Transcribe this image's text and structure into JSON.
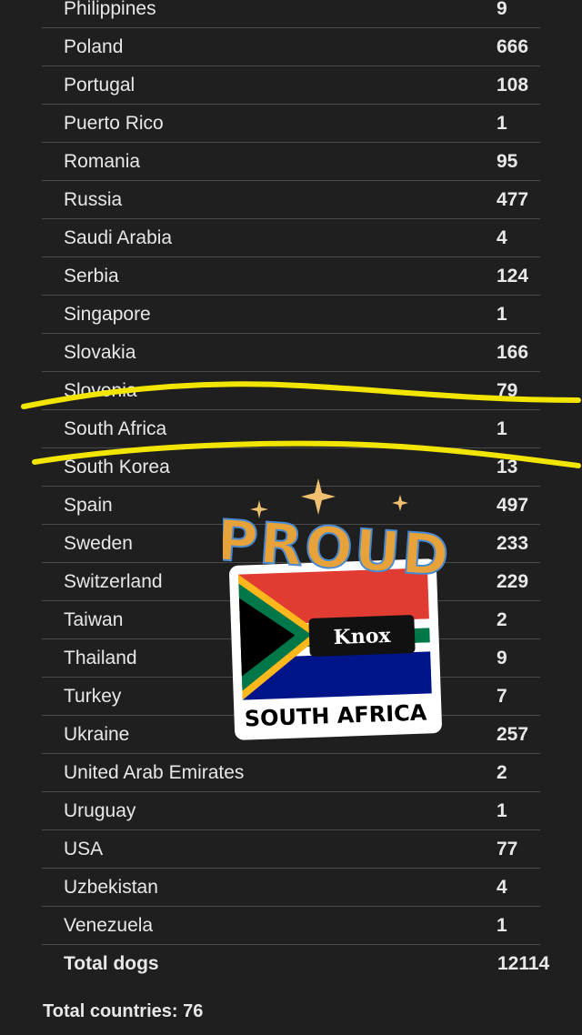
{
  "table": {
    "rows": [
      {
        "country": "Philippines",
        "count": "9"
      },
      {
        "country": "Poland",
        "count": "666"
      },
      {
        "country": "Portugal",
        "count": "108"
      },
      {
        "country": "Puerto Rico",
        "count": "1"
      },
      {
        "country": "Romania",
        "count": "95"
      },
      {
        "country": "Russia",
        "count": "477"
      },
      {
        "country": "Saudi Arabia",
        "count": "4"
      },
      {
        "country": "Serbia",
        "count": "124"
      },
      {
        "country": "Singapore",
        "count": "1"
      },
      {
        "country": "Slovakia",
        "count": "166"
      },
      {
        "country": "Slovenia",
        "count": "79"
      },
      {
        "country": "South Africa",
        "count": "1"
      },
      {
        "country": "South Korea",
        "count": "13"
      },
      {
        "country": "Spain",
        "count": "497"
      },
      {
        "country": "Sweden",
        "count": "233"
      },
      {
        "country": "Switzerland",
        "count": "229"
      },
      {
        "country": "Taiwan",
        "count": "2"
      },
      {
        "country": "Thailand",
        "count": "9"
      },
      {
        "country": "Turkey",
        "count": "7"
      },
      {
        "country": "Ukraine",
        "count": "257"
      },
      {
        "country": "United Arab Emirates",
        "count": "2"
      },
      {
        "country": "Uruguay",
        "count": "1"
      },
      {
        "country": "USA",
        "count": "77"
      },
      {
        "country": "Uzbekistan",
        "count": "4"
      },
      {
        "country": "Venezuela",
        "count": "1"
      }
    ],
    "total_label": "Total dogs",
    "total_value": "12114"
  },
  "footer": {
    "total_countries": "Total countries: 76"
  },
  "sticker": {
    "headline": "PROUD",
    "name_tag": "Knox",
    "caption": "SOUTH AFRICA"
  },
  "colors": {
    "background": "#1f1f1f",
    "highlight": "#f2e600",
    "sticker_text": "#e8a23a",
    "flag_red": "#e03c31",
    "flag_blue": "#001489",
    "flag_green": "#007749",
    "flag_gold": "#ffb81c"
  }
}
